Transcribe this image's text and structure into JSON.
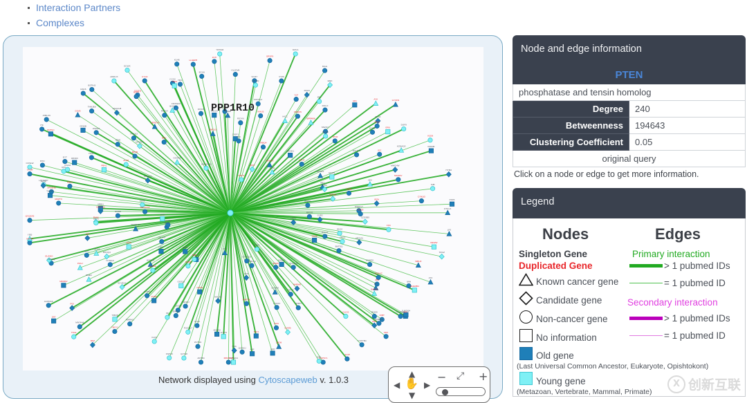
{
  "top_nav": {
    "items": [
      {
        "label": "Interaction Partners"
      },
      {
        "label": "Complexes"
      }
    ]
  },
  "network": {
    "hub_label": "PPP1R10",
    "caption_prefix": "Network displayed using ",
    "caption_link": "Cytoscapeweb",
    "caption_suffix": " v. 1.0.3",
    "controls": {
      "pan_hand": "pan-hand",
      "up": "▲",
      "down": "▼",
      "left": "◀",
      "right": "▶",
      "zoom_out": "−",
      "zoom_fit": "fit-screen",
      "zoom_in": "+",
      "slider_value": 12
    }
  },
  "info_panel": {
    "header": "Node and edge information",
    "gene": "PTEN",
    "description": "phosphatase and tensin homolog",
    "stats": [
      {
        "key": "Degree",
        "value": "240"
      },
      {
        "key": "Betweenness",
        "value": "194643"
      },
      {
        "key": "Clustering Coefficient",
        "value": "0.05"
      }
    ],
    "query_row": "original query",
    "hint": "Click on a node or edge to get more information."
  },
  "legend": {
    "header": "Legend",
    "nodes_title": "Nodes",
    "edges_title": "Edges",
    "singleton": "Singleton Gene",
    "duplicated": "Duplicated Gene",
    "shapes": [
      {
        "shape": "triangle",
        "label": "Known cancer gene"
      },
      {
        "shape": "diamond",
        "label": "Candidate gene"
      },
      {
        "shape": "circle",
        "label": "Non-cancer gene"
      },
      {
        "shape": "square",
        "label": "No information"
      }
    ],
    "old_gene": "Old gene",
    "old_gene_sub": "(Last Universal Common Ancestor, Eukaryote, Opishtokont)",
    "young_gene": "Young gene",
    "young_gene_sub": "(Metazoan, Vertebrate, Mammal, Primate)",
    "primary_title": "Primary interaction",
    "primary_thick": "> 1 pubmed IDs",
    "primary_thin": "= 1 pubmed ID",
    "secondary_title": "Secondary interaction",
    "secondary_thick": "> 1 pubmed IDs",
    "secondary_thin": "= 1 pubmed ID"
  },
  "colors": {
    "panel_header_bg": "#3a414e",
    "gene_blue": "#4a86d8",
    "duplicated_red": "#e8262a",
    "primary_edge": "#22aa22",
    "primary_edge_thin": "#4ec04e",
    "secondary_edge": "#bb00bb",
    "secondary_edge_thin": "#e07ae0",
    "old_gene": "#1f7fb8",
    "young_gene": "#7ff0f5",
    "network_border": "#79a9c4",
    "link_blue": "#5b9bd5"
  },
  "watermark": {
    "mark": "X",
    "text": "创新互联"
  }
}
